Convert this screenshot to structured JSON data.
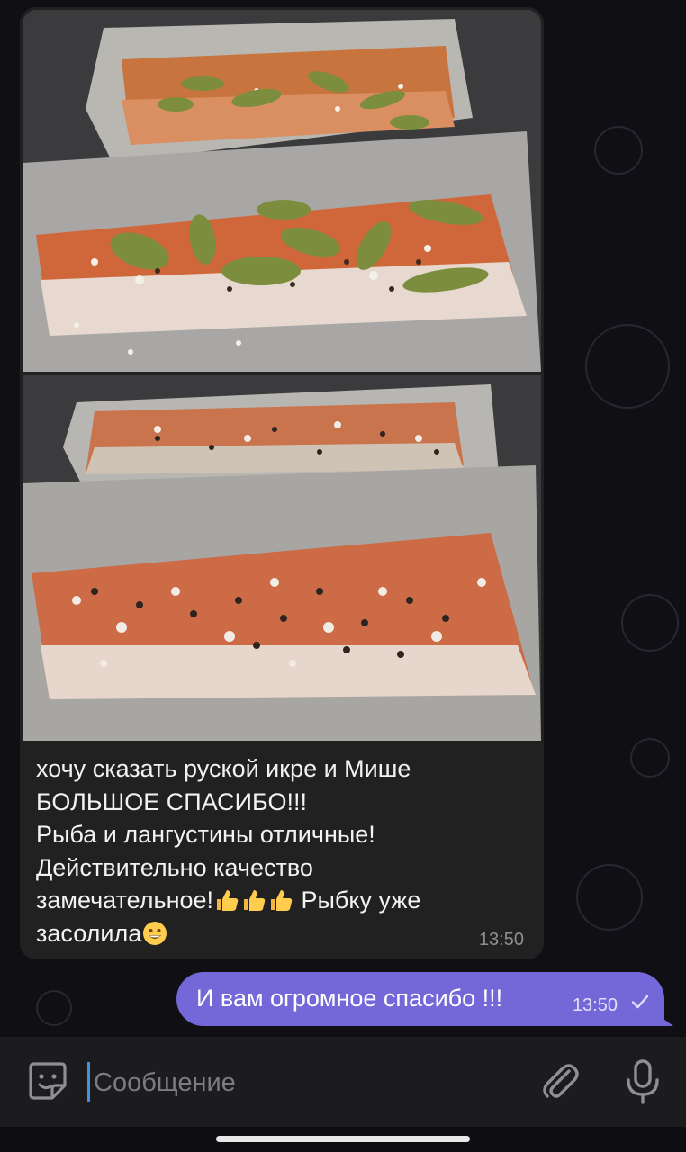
{
  "colors": {
    "chat_background": "#0f0f14",
    "incoming_bubble": "#212121",
    "outgoing_bubble": "#7467d8",
    "input_bar": "#1c1c1e",
    "cursor": "#4a90e2"
  },
  "incoming_message": {
    "photos": [
      {
        "description_icon": "photo-salted-fish-with-bay-leaves"
      },
      {
        "description_icon": "photo-salted-fish-with-peppercorns"
      }
    ],
    "text_lines": [
      "хочу сказать руской икре и Мише",
      "БОЛЬШОЕ СПАСИБО!!!",
      "Рыба и лангустины отличные!",
      "Действительно качество",
      "замечательное!",
      " Рыбку уже",
      "засолила"
    ],
    "emojis": [
      "thumbs-up-icon",
      "thumbs-up-icon",
      "thumbs-up-icon",
      "grinning-face-icon"
    ],
    "time": "13:50"
  },
  "outgoing_message": {
    "text": "И вам огромное спасибо !!!",
    "time": "13:50",
    "status_icon": "single-check-icon"
  },
  "composer": {
    "placeholder": "Сообщение",
    "left_icon": "sticker-icon",
    "attach_icon": "paperclip-icon",
    "mic_icon": "microphone-icon"
  }
}
